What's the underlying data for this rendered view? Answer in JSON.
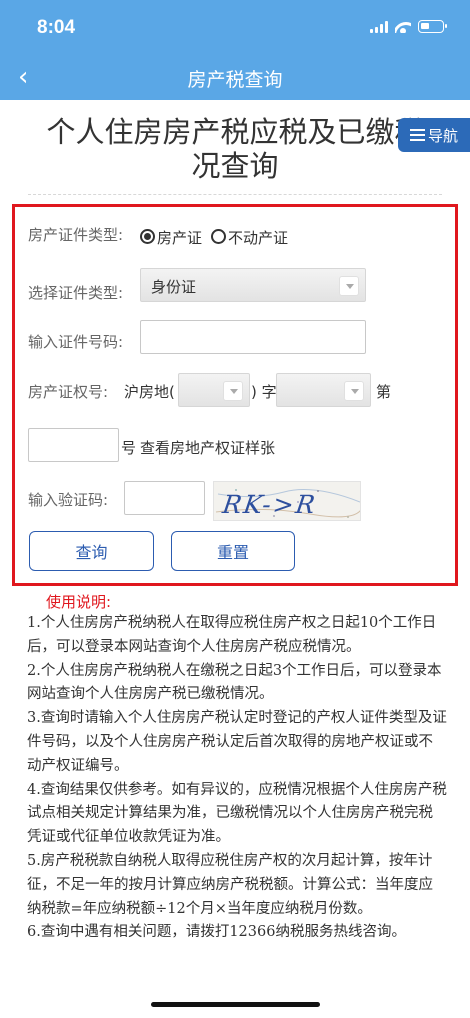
{
  "status_bar": {
    "time": "8:04"
  },
  "nav": {
    "title": "房产税查询"
  },
  "page": {
    "title_line1": "个人住房房产税应税及已缴税",
    "title_line2": "况查询",
    "nav_button_label": "导航"
  },
  "form": {
    "cert_type_label": "房产证件类型:",
    "cert_type_options": [
      {
        "label": "房产证",
        "checked": true
      },
      {
        "label": "不动产证",
        "checked": false
      }
    ],
    "id_type_label": "选择证件类型:",
    "id_type_value": "身份证",
    "id_number_label": "输入证件号码:",
    "id_number_value": "",
    "property_cert_label": "房产证权号:",
    "property_prefix": "沪房地(",
    "district_value": "",
    "paren_close_zi": ") 字",
    "year_value": "",
    "di": "第",
    "number_value": "",
    "hao": "号",
    "view_sample_link": "查看房地产权证样张",
    "captcha_label": "输入验证码:",
    "captcha_value": "",
    "captcha_text": "RK->R",
    "query_button": "查询",
    "reset_button": "重置"
  },
  "instructions": {
    "title": "使用说明:",
    "items": [
      "1.个人住房房产税纳税人在取得应税住房产权之日起10个工作日后，可以登录本网站查询个人住房房产税应税情况。",
      "2.个人住房房产税纳税人在缴税之日起3个工作日后，可以登录本网站查询个人住房房产税已缴税情况。",
      "3.查询时请输入个人住房房产税认定时登记的产权人证件类型及证件号码，以及个人住房房产税认定后首次取得的房地产权证或不动产权证编号。",
      "4.查询结果仅供参考。如有异议的，应税情况根据个人住房房产税试点相关规定计算结果为准，已缴税情况以个人住房房产税完税凭证或代征单位收款凭证为准。",
      "5.房产税税款自纳税人取得应税住房产权的次月起计算，按年计征，不足一年的按月计算应纳房产税税额。计算公式：当年度应纳税款=年应纳税额÷12个月×当年度应纳税月份数。",
      "6.查询中遇有相关问题，请拨打12366纳税服务热线咨询。"
    ]
  },
  "colors": {
    "header_bg": "#5aa7e6",
    "nav_button_bg": "#2c6ab8",
    "highlight_border": "#e0171e",
    "button_border": "#2c5cb0",
    "instructions_title": "#e0171e"
  },
  "icons": [
    "back-chevron-icon",
    "signal-icon",
    "wifi-icon",
    "battery-icon",
    "menu-icon",
    "dropdown-arrow-icon"
  ]
}
